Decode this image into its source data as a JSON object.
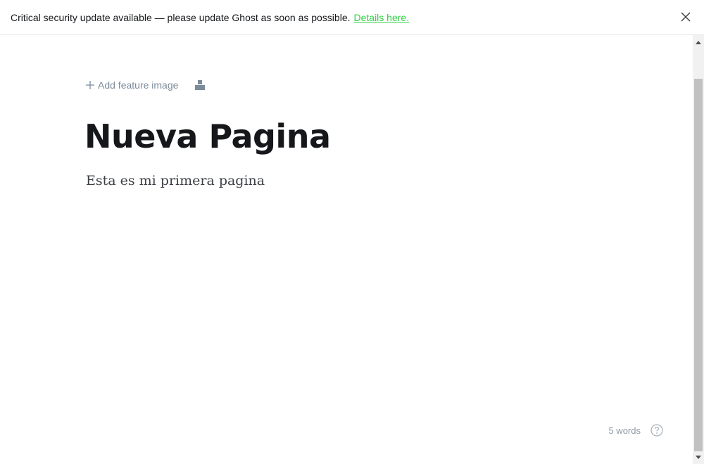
{
  "banner": {
    "message": "Critical security update available — please update Ghost as soon as possible.",
    "link_text": "Details here.",
    "close_icon": "close-icon"
  },
  "editor": {
    "add_feature_image": "Add feature image",
    "title": "Nueva Pagina",
    "body": "Esta es mi primera pagina",
    "word_count": "5 words"
  },
  "icons": {
    "plus": "plus-icon",
    "snippet": "snippet-icon",
    "help": "help-icon"
  },
  "colors": {
    "link": "#30cf43",
    "muted": "#7c8b9a",
    "title": "#15171a"
  }
}
